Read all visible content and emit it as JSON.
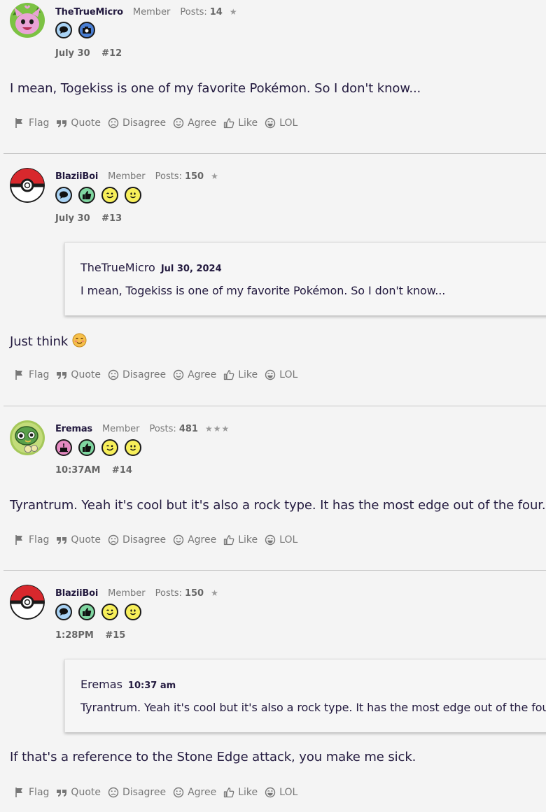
{
  "posts": [
    {
      "username": "TheTrueMicro",
      "role": "Member",
      "posts_label": "Posts:",
      "posts_count": "14",
      "stars": "★",
      "badges": [
        "chat-badge",
        "camera-badge"
      ],
      "date": "July 30",
      "number": "#12",
      "quote": null,
      "body": "I mean, Togekiss is one of my favorite Pokémon. So I don't know..."
    },
    {
      "username": "BlaziiBoi",
      "role": "Member",
      "posts_label": "Posts:",
      "posts_count": "150",
      "stars": "★",
      "badges": [
        "chat-badge",
        "thumbs-up-badge",
        "wink-badge",
        "smile-badge"
      ],
      "date": "July 30",
      "number": "#13",
      "quote": {
        "author": "TheTrueMicro",
        "date": "Jul 30, 2024",
        "text": "I mean, Togekiss is one of my favorite Pokémon. So I don't know..."
      },
      "body": "Just think"
    },
    {
      "username": "Eremas",
      "role": "Member",
      "posts_label": "Posts:",
      "posts_count": "481",
      "stars": "★★★",
      "badges": [
        "cake-badge",
        "thumbs-up-badge",
        "wink-badge",
        "smile-badge"
      ],
      "date": "10:37AM",
      "number": "#14",
      "quote": null,
      "body": "Tyrantrum. Yeah it's cool but it's also a rock type. It has the most edge out of the four."
    },
    {
      "username": "BlaziiBoi",
      "role": "Member",
      "posts_label": "Posts:",
      "posts_count": "150",
      "stars": "★",
      "badges": [
        "chat-badge",
        "thumbs-up-badge",
        "wink-badge",
        "smile-badge"
      ],
      "date": "1:28PM",
      "number": "#15",
      "quote": {
        "author": "Eremas",
        "date": "10:37 am",
        "text": "Tyrantrum. Yeah it's cool but it's also a rock type. It has the most edge out of the four."
      },
      "body": "If that's a reference to the Stone Edge attack, you make me sick."
    }
  ],
  "actions": {
    "flag": "Flag",
    "quote": "Quote",
    "disagree": "Disagree",
    "agree": "Agree",
    "like": "Like",
    "lol": "LOL"
  },
  "colors": {
    "background": "#f4f4f4",
    "text": "#231a3f",
    "muted": "#777777",
    "badge_blue": "#a9d3f5",
    "badge_camera": "#4a7fd4",
    "badge_green": "#7fd6a0",
    "badge_yellow": "#f7ef5a",
    "badge_pink": "#e58ac1"
  }
}
